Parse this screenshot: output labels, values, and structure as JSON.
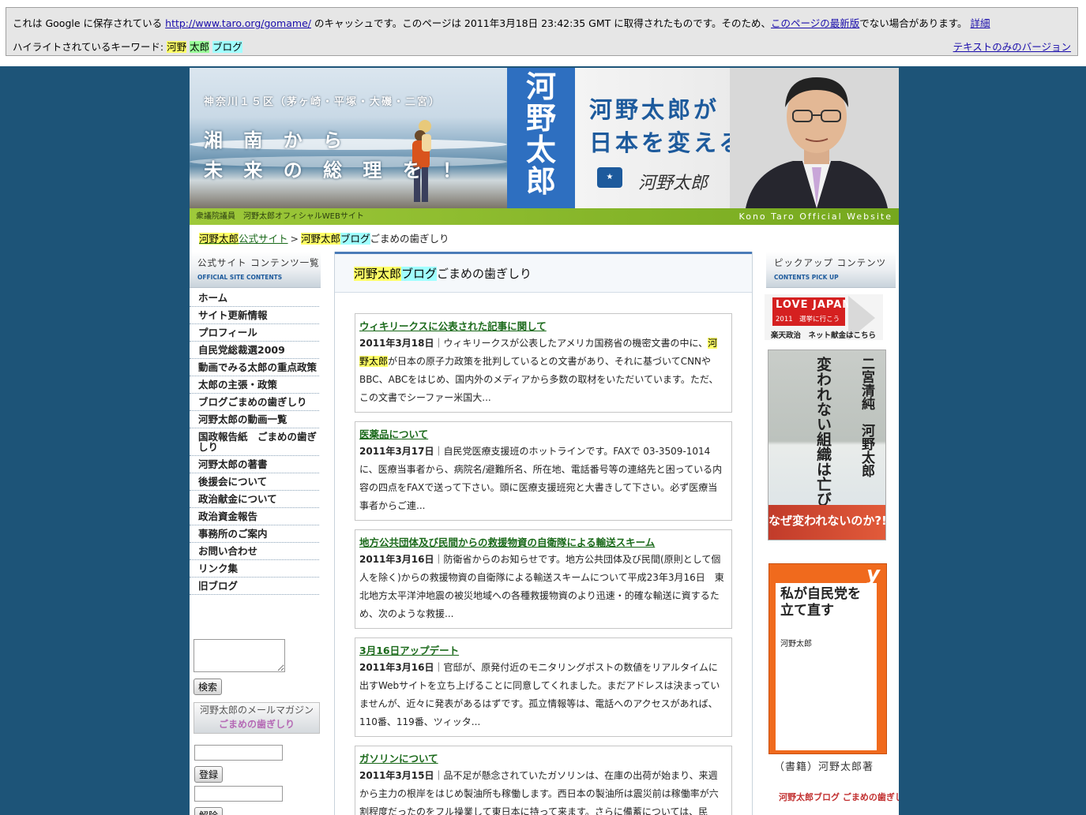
{
  "cache_bar": {
    "line1_prefix": "これは Google に保存されている",
    "cached_url": "http://www.taro.org/gomame/",
    "line1_mid": "のキャッシュです。このページは 2011年3月18日 23:42:35 GMT に取得されたものです。そのため、",
    "latest_link": "このページの最新版",
    "line1_suffix": "でない場合があります。",
    "details_link": "詳細",
    "keywords_label": "ハイライトされているキーワード:",
    "keywords": [
      "河野",
      "太郎",
      "ブログ"
    ],
    "text_only_link": "テキストのみのバージョン"
  },
  "banner": {
    "area": "神奈川１５区（茅ヶ崎・平塚・大磯・二宮）",
    "slogan1": "湘 南 か ら",
    "slogan2": "未 来 の 総 理 を ！",
    "name_vertical": "河野太郎",
    "headline1": "河野太郎が",
    "headline2": "日本を変える。",
    "signature": "河野太郎",
    "green_left": "衆議院議員　河野太郎オフィシャルWEBサイト",
    "green_right": "Kono Taro Official Website"
  },
  "breadcrumb": {
    "home_kw": "河野太郎",
    "home_rest": "公式サイト",
    "sep": ">",
    "current_kw1": "河野太郎",
    "current_kw2": "ブログ",
    "current_rest": "ごまめの歯ぎしり"
  },
  "left_nav": {
    "head_jp": "公式サイト コンテンツ一覧",
    "head_en": "OFFICIAL SITE CONTENTS",
    "items": [
      "ホーム",
      "サイト更新情報",
      "プロフィール",
      "自民党総裁選2009",
      "動画でみる太郎の重点政策",
      "太郎の主張・政策",
      "ブログごまめの歯ぎしり",
      "河野太郎の動画一覧",
      "国政報告紙　ごまめの歯ぎしり",
      "河野太郎の著書",
      "後援会について",
      "政治献金について",
      "政治資金報告",
      "事務所のご案内",
      "お問い合わせ",
      "リンク集",
      "旧ブログ"
    ],
    "search_button": "検索",
    "mailmag_line1": "河野太郎のメールマガジン",
    "mailmag_line2": "ごまめの歯ぎしり",
    "register_button": "登録",
    "unsubscribe_button": "解除"
  },
  "main": {
    "title_kw1": "河野太郎",
    "title_kw2": "ブログ",
    "title_rest": "ごまめの歯ぎしり",
    "posts": [
      {
        "title": "ウィキリークスに公表された記事に関して",
        "date": "2011年3月18日",
        "body_pre": "｜ウィキリークスが公表したアメリカ国務省の機密文書の中に、",
        "kw": "河野太郎",
        "body_post": "が日本の原子力政策を批判しているとの文書があり、それに基づいてCNNやBBC、ABCをはじめ、国内外のメディアから多数の取材をいただいています。ただ、この文書でシーファー米国大..."
      },
      {
        "title": "医薬品について",
        "date": "2011年3月17日",
        "body_pre": "｜自民党医療支援班のホットラインです。FAXで 03-3509-1014 に、医療当事者から、病院名/避難所名、所在地、電話番号等の連絡先と困っている内容の四点をFAXで送って下さい。頭に医療支援班宛と大書きして下さい。必ず医療当事者からご連...",
        "kw": "",
        "body_post": ""
      },
      {
        "title": "地方公共団体及び民間からの救援物資の自衛隊による輸送スキーム",
        "date": "2011年3月16日",
        "body_pre": "｜防衛省からのお知らせです。地方公共団体及び民間(原則として個人を除く)からの救援物資の自衛隊による輸送スキームについて平成23年3月16日　東北地方太平洋沖地震の被災地域への各種救援物資のより迅速・的確な輸送に資するため、次のような救援...",
        "kw": "",
        "body_post": ""
      },
      {
        "title": "3月16日アップデート",
        "date": "2011年3月16日",
        "body_pre": "｜官邸が、原発付近のモニタリングポストの数値をリアルタイムに出すWebサイトを立ち上げることに同意してくれました。まだアドレスは決まっていませんが、近々に発表があるはずです。孤立情報等は、電話へのアクセスがあれば、110番、119番、ツィッタ...",
        "kw": "",
        "body_post": ""
      },
      {
        "title": "ガソリンについて",
        "date": "2011年3月15日",
        "body_pre": "｜品不足が懸念されていたガソリンは、在庫の出荷が始まり、来週から主力の根岸をはじめ製油所も稼働します。西日本の製油所は震災前は稼働率が六割程度だったのをフル操業して東日本に持って来ます。さらに備蓄については、民",
        "kw": "",
        "body_post": ""
      }
    ]
  },
  "right_col": {
    "head_jp": "ピックアップ コンテンツ",
    "head_en": "CONTENTS PICK UP",
    "lovejapan_title": "LOVE JAPAN",
    "lovejapan_sub": "2011　選挙に行こう",
    "lovejapan_caption": "楽天政治　ネット献金はこちら",
    "book1_authors": "二宮清純　河野太郎",
    "book1_title": "変われない組織は亡びる",
    "book1_band": "なぜ変われないのか?!",
    "book2_title": "私が自民党を立て直す",
    "book2_author": "河野太郎",
    "book2_mark": "y",
    "book_caption": "（書籍）河野太郎著",
    "blog_banner": "河野太郎ブログ ごまめの歯ぎしり"
  },
  "colors": {
    "background": "#1d5478",
    "accent_blue": "#2e6fc0",
    "green_bar": "#9ec93a",
    "post_title": "#1b6a1b",
    "keyword_yellow": "#ffff66",
    "keyword_cyan": "#a0ffff",
    "keyword_green": "#99ff99"
  }
}
